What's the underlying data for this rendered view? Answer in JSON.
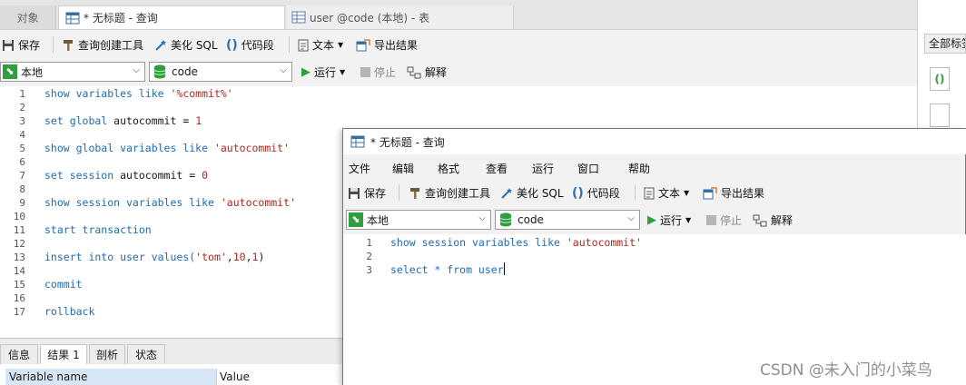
{
  "tabs": {
    "objects": "对象",
    "query": "* 无标题 - 查询",
    "table": "user @code (本地) - 表"
  },
  "toolbar": {
    "save": "保存",
    "query_builder": "查询创建工具",
    "beautify": "美化 SQL",
    "snippet": "代码段",
    "text": "文本",
    "export": "导出结果"
  },
  "connection": {
    "value": "本地"
  },
  "database": {
    "value": "code"
  },
  "run_bar": {
    "run": "运行",
    "stop": "停止",
    "explain": "解释"
  },
  "editor": {
    "line_numbers": [
      "1",
      "2",
      "3",
      "4",
      "5",
      "6",
      "7",
      "8",
      "9",
      "10",
      "11",
      "12",
      "13",
      "14",
      "15",
      "16",
      "17"
    ],
    "lines": [
      {
        "n": "1",
        "parts": [
          {
            "t": "show variables like ",
            "c": "kw"
          },
          {
            "t": "'%commit%'",
            "c": "str"
          }
        ]
      },
      {
        "n": "3",
        "parts": [
          {
            "t": "set global ",
            "c": "kw"
          },
          {
            "t": "autocommit = ",
            "c": "plain"
          },
          {
            "t": "1",
            "c": "num"
          }
        ]
      },
      {
        "n": "5",
        "parts": [
          {
            "t": "show global variables like ",
            "c": "kw"
          },
          {
            "t": "'autocommit'",
            "c": "str"
          }
        ]
      },
      {
        "n": "7",
        "parts": [
          {
            "t": "set session ",
            "c": "kw"
          },
          {
            "t": "autocommit = ",
            "c": "plain"
          },
          {
            "t": "0",
            "c": "num"
          }
        ]
      },
      {
        "n": "9",
        "parts": [
          {
            "t": "show session variables like ",
            "c": "kw"
          },
          {
            "t": "'autocommit'",
            "c": "str"
          }
        ]
      },
      {
        "n": "11",
        "parts": [
          {
            "t": "start transaction",
            "c": "kw"
          }
        ]
      },
      {
        "n": "13",
        "parts": [
          {
            "t": "insert into user values(",
            "c": "kw"
          },
          {
            "t": "'tom'",
            "c": "str"
          },
          {
            "t": ",",
            "c": "plain"
          },
          {
            "t": "10",
            "c": "num"
          },
          {
            "t": ",",
            "c": "plain"
          },
          {
            "t": "1",
            "c": "num"
          },
          {
            "t": ")",
            "c": "plain"
          }
        ]
      },
      {
        "n": "15",
        "parts": [
          {
            "t": "commit",
            "c": "kw"
          }
        ]
      },
      {
        "n": "17",
        "parts": [
          {
            "t": "rollback",
            "c": "kw"
          }
        ]
      }
    ]
  },
  "bottom_tabs": [
    "信息",
    "结果 1",
    "剖析",
    "状态"
  ],
  "result_headers": [
    "Variable name",
    "Value"
  ],
  "right_panel": {
    "all_tags": "全部标签"
  },
  "floating_window": {
    "title": "* 无标题 - 查询",
    "menu": [
      "文件",
      "编辑",
      "格式",
      "查看",
      "运行",
      "窗口",
      "帮助"
    ],
    "toolbar": {
      "save": "保存",
      "query_builder": "查询创建工具",
      "beautify": "美化 SQL",
      "snippet": "代码段",
      "text": "文本",
      "export": "导出结果"
    },
    "connection": "本地",
    "database": "code",
    "run": "运行",
    "stop": "停止",
    "explain": "解释",
    "line_numbers": [
      "1",
      "2",
      "3"
    ],
    "lines": [
      {
        "parts": [
          {
            "t": "show session variables like ",
            "c": "kw"
          },
          {
            "t": "'autocommit'",
            "c": "str"
          }
        ]
      },
      {
        "parts": []
      },
      {
        "parts": [
          {
            "t": "select * from user",
            "c": "kw"
          }
        ]
      }
    ]
  },
  "watermark": "CSDN @未入门的小菜鸟"
}
